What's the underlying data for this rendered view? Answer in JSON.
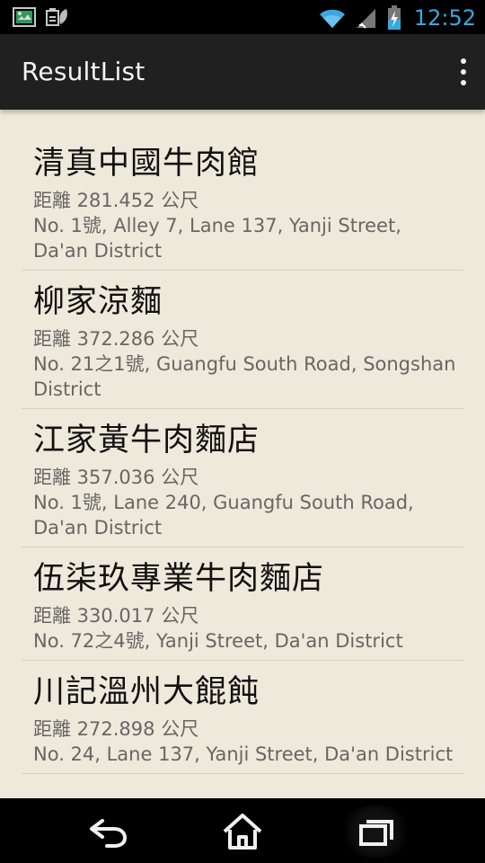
{
  "status_bar": {
    "time": "12:52",
    "icons": [
      "gallery-icon",
      "battery-saver-icon",
      "wifi-icon",
      "signal-icon",
      "battery-charging-icon"
    ],
    "accent_color": "#38a9e0"
  },
  "action_bar": {
    "title": "ResultList",
    "overflow_icon": "more-vert-icon"
  },
  "results": [
    {
      "name": "清真中國牛肉館",
      "distance": "距離 281.452 公尺",
      "address": "No. 1號, Alley 7, Lane 137, Yanji Street, Da'an District"
    },
    {
      "name": "柳家涼麵",
      "distance": "距離 372.286 公尺",
      "address": "No. 21之1號, Guangfu South Road, Songshan District"
    },
    {
      "name": "江家黃牛肉麵店",
      "distance": "距離 357.036 公尺",
      "address": "No. 1號, Lane 240, Guangfu South Road, Da'an District"
    },
    {
      "name": "伍柒玖專業牛肉麵店",
      "distance": "距離 330.017 公尺",
      "address": "No. 72之4號, Yanji Street, Da'an District"
    },
    {
      "name": "川記溫州大餛飩",
      "distance": "距離 272.898 公尺",
      "address": "No. 24, Lane 137, Yanji Street, Da'an District"
    }
  ],
  "navigation": {
    "back_icon": "back-icon",
    "home_icon": "home-icon",
    "recents_icon": "recent-apps-icon"
  },
  "colors": {
    "background": "#efe9db",
    "action_bar": "#202020",
    "primary_text": "#111111",
    "secondary_text": "#666666",
    "divider": "#d8d1c3"
  }
}
